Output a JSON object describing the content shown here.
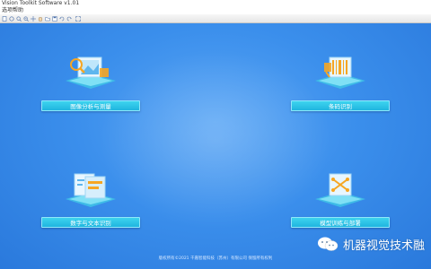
{
  "window": {
    "title": "Vision Toolkit Software v1.01"
  },
  "menu": {
    "items": [
      "选项",
      "帮助"
    ]
  },
  "toolbar": {
    "icons": [
      "new-icon",
      "open-icon",
      "zoom-in-icon",
      "zoom-out-icon",
      "crosshair-icon",
      "hand-icon",
      "folder-icon",
      "save-icon",
      "rotate-left-icon",
      "rotate-right-icon",
      "fullscreen-icon"
    ]
  },
  "modules": [
    {
      "label": "图像分析与测量",
      "icon": "image-analysis-icon"
    },
    {
      "label": "条码识别",
      "icon": "barcode-icon"
    },
    {
      "label": "数字与文本识别",
      "icon": "ocr-icon"
    },
    {
      "label": "模型训练与部署",
      "icon": "model-training-icon"
    }
  ],
  "footer": {
    "text": "版权所有©2021 千嘉智能科技（苏州）有限公司  保留所有权利"
  },
  "watermark": {
    "text": "机器视觉技术融"
  },
  "colors": {
    "background": "#3b8fec",
    "button": "#1fb5df",
    "accent_orange": "#f6a623"
  }
}
